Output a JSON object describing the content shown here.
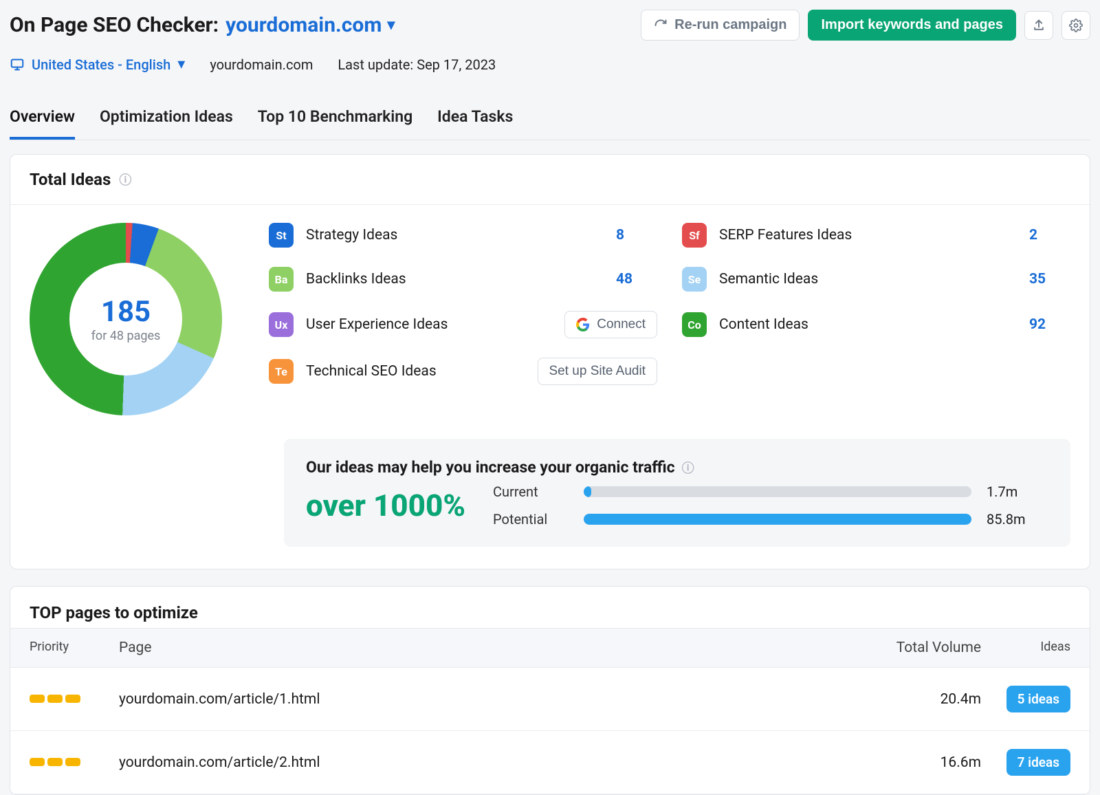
{
  "header": {
    "title_prefix": "On Page SEO Checker:",
    "domain": "yourdomain.com",
    "rerun_label": "Re-run campaign",
    "import_label": "Import keywords and pages",
    "locale": "United States - English",
    "domain_text": "yourdomain.com",
    "last_update": "Last update: Sep 17, 2023"
  },
  "tabs": [
    "Overview",
    "Optimization Ideas",
    "Top 10 Benchmarking",
    "Idea Tasks"
  ],
  "total_ideas": {
    "title": "Total Ideas",
    "donut_total": "185",
    "donut_sub": "for 48 pages",
    "categories": [
      {
        "code": "St",
        "label": "Strategy Ideas",
        "count": "8",
        "color": "#1a6dd6"
      },
      {
        "code": "Sf",
        "label": "SERP Features Ideas",
        "count": "2",
        "color": "#e44d4d"
      },
      {
        "code": "Ba",
        "label": "Backlinks Ideas",
        "count": "48",
        "color": "#8ed064"
      },
      {
        "code": "Se",
        "label": "Semantic Ideas",
        "count": "35",
        "color": "#a3d2f4"
      },
      {
        "code": "Ux",
        "label": "User Experience Ideas",
        "action": "Connect",
        "color": "#9a6fdc"
      },
      {
        "code": "Co",
        "label": "Content Ideas",
        "count": "92",
        "color": "#30a430"
      },
      {
        "code": "Te",
        "label": "Technical SEO Ideas",
        "action": "Set up Site Audit",
        "color": "#f7933a"
      }
    ]
  },
  "traffic": {
    "title": "Our ideas may help you increase your organic traffic",
    "big": "over 1000%",
    "current_label": "Current",
    "current_value": "1.7m",
    "current_pct": 2,
    "potential_label": "Potential",
    "potential_value": "85.8m",
    "potential_pct": 100
  },
  "top_pages": {
    "title": "TOP pages to optimize",
    "columns": {
      "priority": "Priority",
      "page": "Page",
      "volume": "Total Volume",
      "ideas": "Ideas"
    },
    "rows": [
      {
        "page": "yourdomain.com/article/1.html",
        "volume": "20.4m",
        "ideas": "5 ideas"
      },
      {
        "page": "yourdomain.com/article/2.html",
        "volume": "16.6m",
        "ideas": "7 ideas"
      }
    ]
  },
  "chart_data": {
    "type": "pie",
    "title": "Total Ideas",
    "values": [
      {
        "name": "SERP Features Ideas",
        "value": 2,
        "color": "#e44d4d"
      },
      {
        "name": "Strategy Ideas",
        "value": 8,
        "color": "#1a6dd6"
      },
      {
        "name": "Backlinks Ideas",
        "value": 48,
        "color": "#8ed064"
      },
      {
        "name": "Semantic Ideas",
        "value": 35,
        "color": "#a3d2f4"
      },
      {
        "name": "Content Ideas",
        "value": 92,
        "color": "#30a430"
      }
    ],
    "total": 185,
    "subtitle": "for 48 pages"
  }
}
